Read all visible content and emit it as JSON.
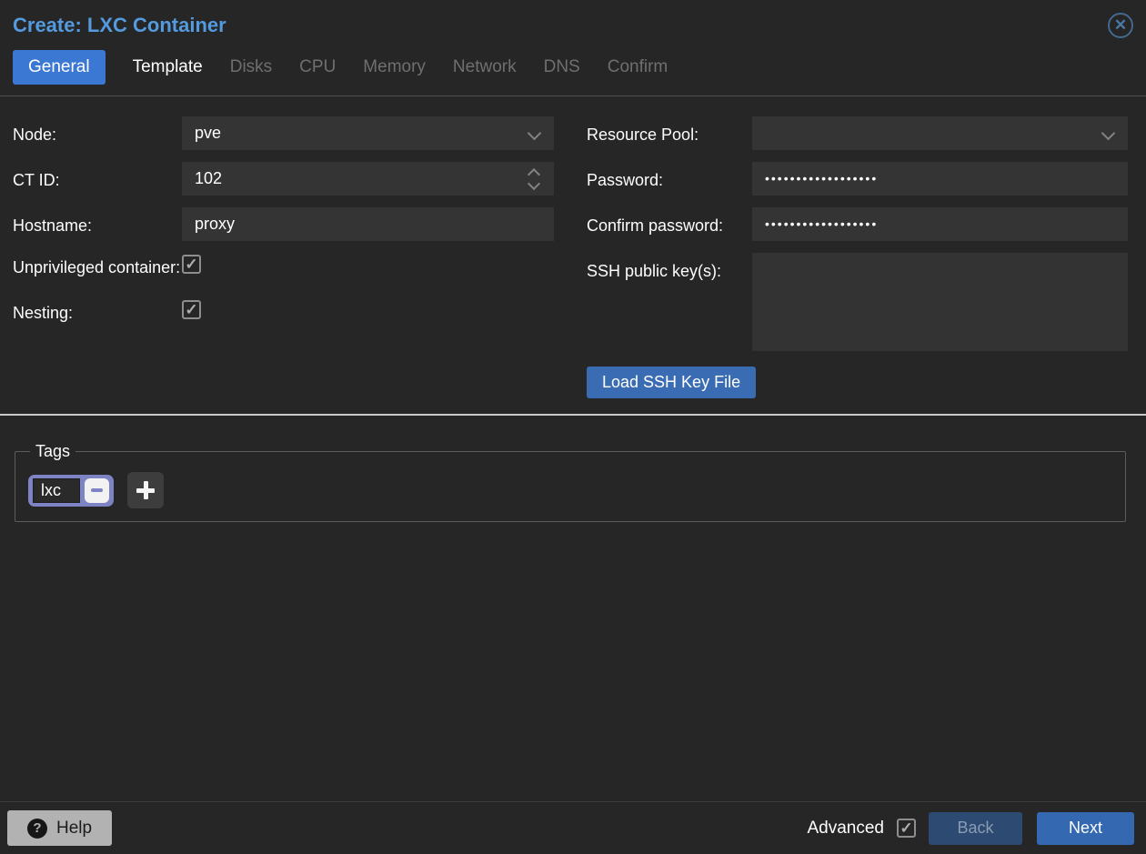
{
  "dialog": {
    "title": "Create: LXC Container"
  },
  "tabs": [
    {
      "label": "General",
      "state": "active"
    },
    {
      "label": "Template",
      "state": "enabled"
    },
    {
      "label": "Disks",
      "state": "disabled"
    },
    {
      "label": "CPU",
      "state": "disabled"
    },
    {
      "label": "Memory",
      "state": "disabled"
    },
    {
      "label": "Network",
      "state": "disabled"
    },
    {
      "label": "DNS",
      "state": "disabled"
    },
    {
      "label": "Confirm",
      "state": "disabled"
    }
  ],
  "form": {
    "node": {
      "label": "Node:",
      "value": "pve"
    },
    "ct_id": {
      "label": "CT ID:",
      "value": "102"
    },
    "hostname": {
      "label": "Hostname:",
      "value": "proxy"
    },
    "unprivileged": {
      "label": "Unprivileged container:",
      "checked": true
    },
    "nesting": {
      "label": "Nesting:",
      "checked": true
    },
    "resource_pool": {
      "label": "Resource Pool:",
      "value": ""
    },
    "password": {
      "label": "Password:",
      "value": "••••••••••••••••••"
    },
    "confirm_password": {
      "label": "Confirm password:",
      "value": "••••••••••••••••••"
    },
    "ssh_keys": {
      "label": "SSH public key(s):",
      "value": ""
    },
    "load_ssh_button": "Load SSH Key File"
  },
  "tags": {
    "legend": "Tags",
    "items": [
      {
        "name": "lxc"
      }
    ]
  },
  "footer": {
    "help_label": "Help",
    "help_icon": "?",
    "advanced": {
      "label": "Advanced",
      "checked": true
    },
    "back_label": "Back",
    "next_label": "Next"
  },
  "colors": {
    "background": "#262626",
    "title_blue": "#539ade",
    "active_tab_blue": "#3b78d4",
    "button_blue": "#3468b1",
    "back_button_blue": "#2c4a72",
    "field_background": "#343434",
    "tag_periwinkle": "#7e83c3",
    "help_gray": "#b2b2b2",
    "bright_divider": "#c9c9c9"
  }
}
